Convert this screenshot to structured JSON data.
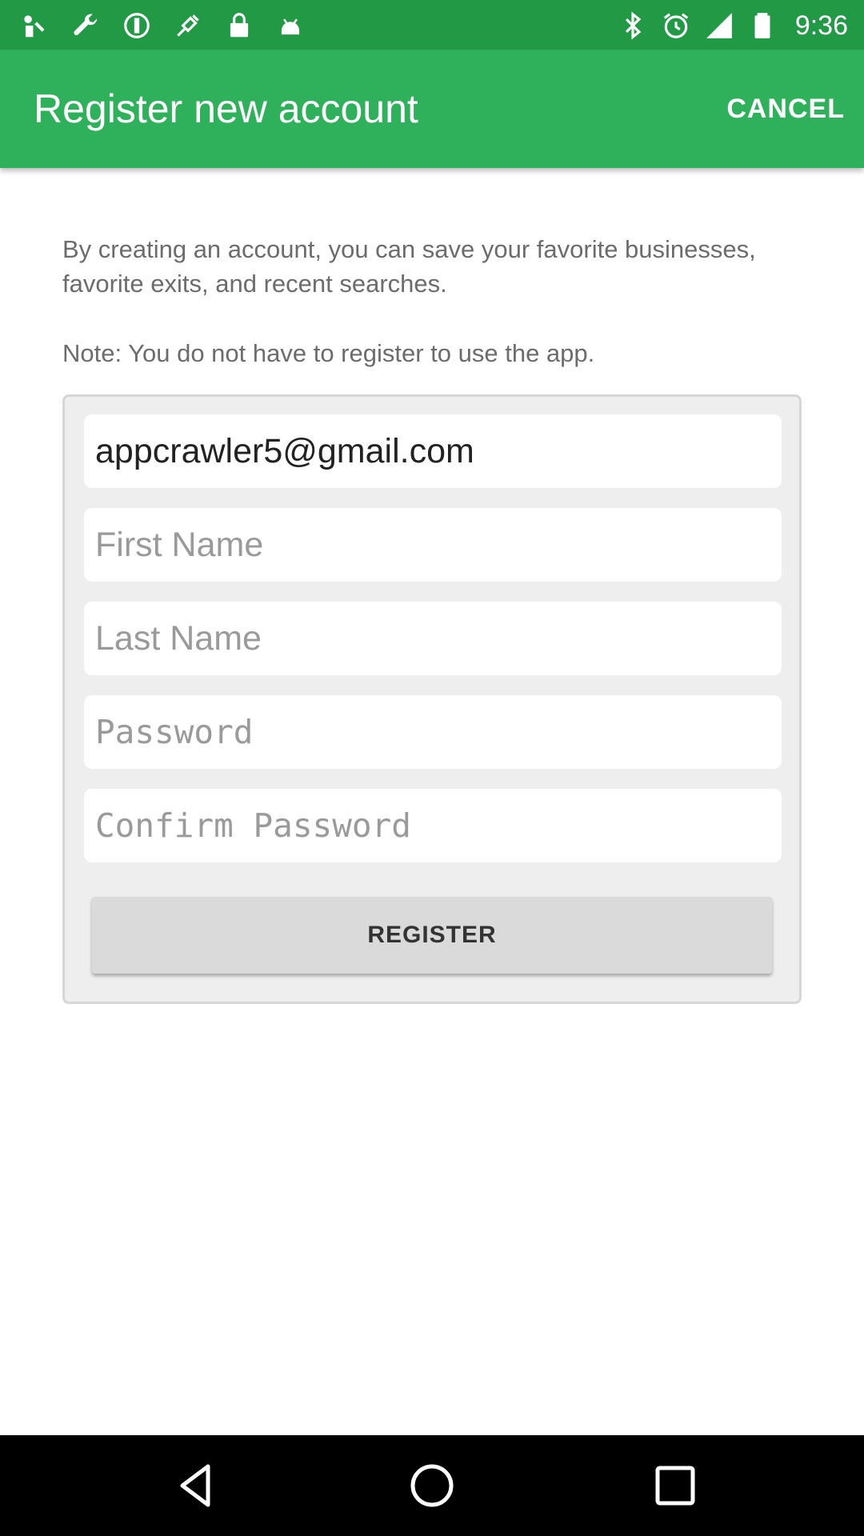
{
  "status_bar": {
    "time": "9:36",
    "left_icons": [
      "notification-icon",
      "wrench-icon",
      "sync-icon",
      "fake-gps-icon",
      "lock-icon",
      "android-icon"
    ],
    "right_icons": [
      "bluetooth-icon",
      "alarm-icon",
      "signal-icon",
      "battery-icon"
    ]
  },
  "app_bar": {
    "title": "Register new account",
    "cancel_label": "CANCEL",
    "background_color": "#2eb15a"
  },
  "intro": {
    "text": "By creating an account, you can save your favorite businesses, favorite exits, and recent searches.",
    "note": "Note: You do not have to register to use the app."
  },
  "form": {
    "email_value": "appcrawler5@gmail.com",
    "first_name_placeholder": "First Name",
    "last_name_placeholder": "Last Name",
    "password_placeholder": "Password",
    "confirm_password_placeholder": "Confirm Password",
    "register_label": "REGISTER"
  },
  "nav_bar": {
    "buttons": [
      "back-icon",
      "home-icon",
      "recents-icon"
    ]
  }
}
